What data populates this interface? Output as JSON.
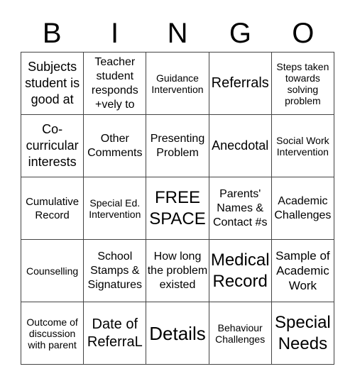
{
  "header": [
    "B",
    "I",
    "N",
    "G",
    "O"
  ],
  "cells": [
    "Subjects student is good at",
    "Teacher student responds +vely to",
    "Guidance Intervention",
    "Referrals",
    "Steps taken towards solving problem",
    "Co-curricular interests",
    "Other Comments",
    "Presenting Problem",
    "Anecdotal",
    "Social Work Intervention",
    "Cumulative Record",
    "Special Ed. Intervention",
    "FREE SPACE",
    "Parents' Names & Contact #s",
    "Academic Challenges",
    "Counselling",
    "School Stamps & Signatures",
    "How long the problem existed",
    "Medical Record",
    "Sample of Academic Work",
    "Outcome of discussion with parent",
    "Date of ReferraL",
    "Details",
    "Behaviour Challenges",
    "Special Needs"
  ]
}
